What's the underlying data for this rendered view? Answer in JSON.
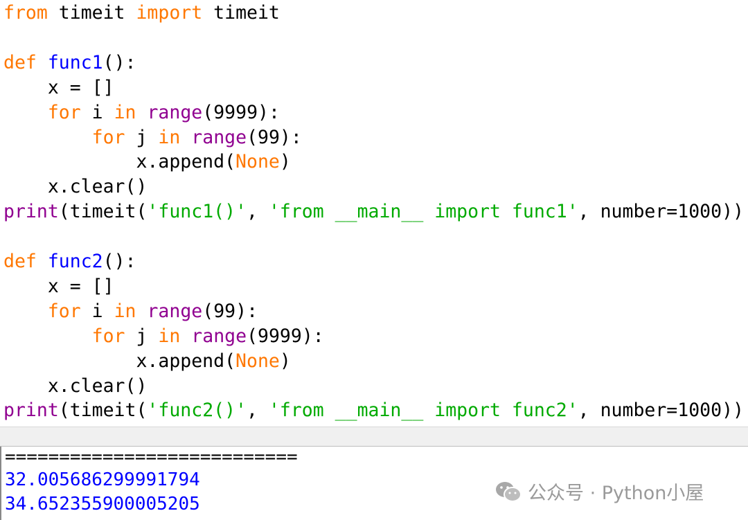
{
  "colors": {
    "keyword": "#ff7700",
    "defname": "#0000ff",
    "builtin": "#900090",
    "string": "#00aa00",
    "plain": "#000000",
    "output": "#0000ff",
    "separator": "#000000"
  },
  "code_lines": [
    [
      [
        "keyword",
        "from"
      ],
      [
        "plain",
        " timeit "
      ],
      [
        "keyword",
        "import"
      ],
      [
        "plain",
        " timeit"
      ]
    ],
    [],
    [
      [
        "keyword",
        "def"
      ],
      [
        "plain",
        " "
      ],
      [
        "defname",
        "func1"
      ],
      [
        "plain",
        "():"
      ]
    ],
    [
      [
        "plain",
        "    x = []"
      ]
    ],
    [
      [
        "plain",
        "    "
      ],
      [
        "keyword",
        "for"
      ],
      [
        "plain",
        " i "
      ],
      [
        "keyword",
        "in"
      ],
      [
        "plain",
        " "
      ],
      [
        "builtin",
        "range"
      ],
      [
        "plain",
        "(9999):"
      ]
    ],
    [
      [
        "plain",
        "        "
      ],
      [
        "keyword",
        "for"
      ],
      [
        "plain",
        " j "
      ],
      [
        "keyword",
        "in"
      ],
      [
        "plain",
        " "
      ],
      [
        "builtin",
        "range"
      ],
      [
        "plain",
        "(99):"
      ]
    ],
    [
      [
        "plain",
        "            x.append("
      ],
      [
        "keyword",
        "None"
      ],
      [
        "plain",
        ")"
      ]
    ],
    [
      [
        "plain",
        "    x.clear()"
      ]
    ],
    [
      [
        "builtin",
        "print"
      ],
      [
        "plain",
        "(timeit("
      ],
      [
        "string",
        "'func1()'"
      ],
      [
        "plain",
        ", "
      ],
      [
        "string",
        "'from __main__ import func1'"
      ],
      [
        "plain",
        ", number=1000))"
      ]
    ],
    [],
    [
      [
        "keyword",
        "def"
      ],
      [
        "plain",
        " "
      ],
      [
        "defname",
        "func2"
      ],
      [
        "plain",
        "():"
      ]
    ],
    [
      [
        "plain",
        "    x = []"
      ]
    ],
    [
      [
        "plain",
        "    "
      ],
      [
        "keyword",
        "for"
      ],
      [
        "plain",
        " i "
      ],
      [
        "keyword",
        "in"
      ],
      [
        "plain",
        " "
      ],
      [
        "builtin",
        "range"
      ],
      [
        "plain",
        "(99):"
      ]
    ],
    [
      [
        "plain",
        "        "
      ],
      [
        "keyword",
        "for"
      ],
      [
        "plain",
        " j "
      ],
      [
        "keyword",
        "in"
      ],
      [
        "plain",
        " "
      ],
      [
        "builtin",
        "range"
      ],
      [
        "plain",
        "(9999):"
      ]
    ],
    [
      [
        "plain",
        "            x.append("
      ],
      [
        "keyword",
        "None"
      ],
      [
        "plain",
        ")"
      ]
    ],
    [
      [
        "plain",
        "    x.clear()"
      ]
    ],
    [
      [
        "builtin",
        "print"
      ],
      [
        "plain",
        "(timeit("
      ],
      [
        "string",
        "'func2()'"
      ],
      [
        "plain",
        ", "
      ],
      [
        "string",
        "'from __main__ import func2'"
      ],
      [
        "plain",
        ", number=1000))"
      ]
    ]
  ],
  "shell": {
    "separator": "===========================",
    "results": [
      "32.005686299991794",
      "34.652355900005205"
    ]
  },
  "watermark": {
    "icon": "wechat-icon",
    "text": "公众号 · Python小屋"
  }
}
